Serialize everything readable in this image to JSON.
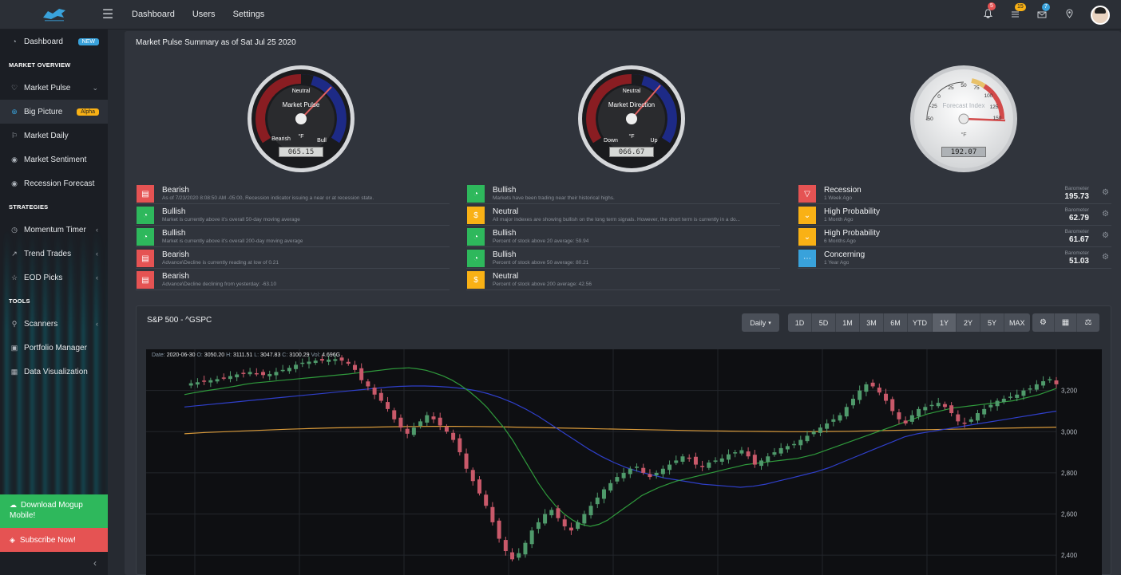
{
  "topbar": {
    "nav": [
      "Dashboard",
      "Users",
      "Settings"
    ],
    "badges": {
      "notifications": "5",
      "list": "15",
      "messages": "7"
    }
  },
  "sidebar": {
    "dashboard": {
      "label": "Dashboard",
      "tag": "NEW"
    },
    "section_market": "MARKET OVERVIEW",
    "market_pulse": "Market Pulse",
    "big_picture": {
      "label": "Big Picture",
      "tag": "Alpha"
    },
    "market_daily": "Market Daily",
    "market_sentiment": "Market Sentiment",
    "recession_forecast": "Recession Forecast",
    "section_strategies": "STRATEGIES",
    "momentum_timer": "Momentum Timer",
    "trend_trades": "Trend Trades",
    "eod_picks": "EOD Picks",
    "section_tools": "TOOLS",
    "scanners": "Scanners",
    "portfolio_manager": "Portfolio Manager",
    "data_visualization": "Data Visualization",
    "download": "Download Mogup Mobile!",
    "subscribe": "Subscribe Now!"
  },
  "summary": {
    "title": "Market Pulse Summary as of Sat Jul 25 2020",
    "gauges": [
      {
        "name": "Market Pulse",
        "top": "Neutral",
        "left": "Bearish",
        "right": "Bull",
        "unit": "°F",
        "readout": "065.15",
        "value": 65.15
      },
      {
        "name": "Market Direction",
        "top": "Neutral",
        "left": "Down",
        "right": "Up",
        "unit": "°F",
        "readout": "066.67",
        "value": 66.67
      },
      {
        "name": "Forecast Index",
        "ticks": [
          "-50",
          "-25",
          "0",
          "25",
          "50",
          "75",
          "100",
          "125",
          "150"
        ],
        "unit": "°F",
        "readout": "192.07",
        "value": 192.07
      }
    ]
  },
  "indicators": {
    "col1": [
      {
        "title": "Bearish",
        "detail": "As of 7/23/2020 8:08:50 AM -05:00, Recession indicator issuing a near or at recession state.",
        "status": "bearish"
      },
      {
        "title": "Bullish",
        "detail": "Market is currently above it's overall 50-day moving average",
        "status": "bullish"
      },
      {
        "title": "Bullish",
        "detail": "Market is currently above it's overall 200-day moving average",
        "status": "bullish"
      },
      {
        "title": "Bearish",
        "detail": "Advance\\Decline is currently reading at low of 0.21",
        "status": "bearish"
      },
      {
        "title": "Bearish",
        "detail": "Advance\\Decline declining from yesterday: -63.10",
        "status": "bearish"
      }
    ],
    "col2": [
      {
        "title": "Bullish",
        "detail": "Markets have been trading near their historical highs.",
        "status": "bullish"
      },
      {
        "title": "Neutral",
        "detail": "All major indexes are showing bullish on the long term signals. However, the short term is currently in a do...",
        "status": "neutral"
      },
      {
        "title": "Bullish",
        "detail": "Percent of stock above 20 average: 59.94",
        "status": "bullish"
      },
      {
        "title": "Bullish",
        "detail": "Percent of stock above 50 average: 80.21",
        "status": "bullish"
      },
      {
        "title": "Neutral",
        "detail": "Percent of stock above 200 average: 42.56",
        "status": "neutral"
      }
    ],
    "col3": [
      {
        "title": "Recession",
        "detail": "1 Week Ago",
        "label": "Barometer",
        "value": "195.73",
        "status": "recession"
      },
      {
        "title": "High Probability",
        "detail": "1 Month Ago",
        "label": "Barometer",
        "value": "62.79",
        "status": "high"
      },
      {
        "title": "High Probability",
        "detail": "6 Months Ago",
        "label": "Barometer",
        "value": "61.67",
        "status": "high"
      },
      {
        "title": "Concerning",
        "detail": "1 Year Ago",
        "label": "Barometer",
        "value": "51.03",
        "status": "concerning"
      }
    ]
  },
  "chartpanel": {
    "title": "S&P 500 - ^GSPC",
    "interval": "Daily",
    "ranges": [
      "1D",
      "5D",
      "1M",
      "3M",
      "6M",
      "YTD",
      "1Y",
      "2Y",
      "5Y",
      "MAX"
    ],
    "active_range": "1Y",
    "ohlc": {
      "date_label": "Date:",
      "date": "2020-06-30",
      "o_label": "O:",
      "o": "3050.20",
      "h_label": "H:",
      "h": "3111.51",
      "l_label": "L:",
      "l": "3047.83",
      "c_label": "C:",
      "c": "3100.29",
      "v_label": "Vol:",
      "v": "4.696G"
    }
  },
  "chart_data": {
    "type": "line",
    "title": "S&P 500 - ^GSPC",
    "ylim": [
      2300,
      3400
    ],
    "yticks": [
      "3,200",
      "3,000",
      "2,800",
      "2,600",
      "2,400"
    ],
    "ytick_values": [
      3200,
      3000,
      2800,
      2600,
      2400
    ],
    "colors": {
      "up": "#4f9a6b",
      "down": "#c9596a",
      "ma20": "#2f9a3c",
      "ma50": "#2f3fc9",
      "ma200": "#d99a3a"
    },
    "closes": [
      3230,
      3235,
      3240,
      3245,
      3250,
      3255,
      3262,
      3270,
      3278,
      3285,
      3290,
      3282,
      3275,
      3280,
      3290,
      3300,
      3310,
      3325,
      3335,
      3340,
      3345,
      3345,
      3350,
      3352,
      3345,
      3330,
      3300,
      3250,
      3220,
      3180,
      3150,
      3110,
      3060,
      3020,
      2990,
      3020,
      3050,
      3080,
      3060,
      3030,
      3000,
      2960,
      2900,
      2820,
      2760,
      2700,
      2640,
      2560,
      2480,
      2420,
      2380,
      2410,
      2460,
      2520,
      2560,
      2600,
      2620,
      2580,
      2540,
      2520,
      2560,
      2600,
      2640,
      2680,
      2720,
      2750,
      2780,
      2800,
      2820,
      2830,
      2800,
      2780,
      2800,
      2820,
      2840,
      2860,
      2880,
      2870,
      2840,
      2830,
      2850,
      2860,
      2870,
      2890,
      2900,
      2910,
      2880,
      2840,
      2860,
      2880,
      2900,
      2920,
      2930,
      2940,
      2960,
      2980,
      3000,
      3020,
      3040,
      3060,
      3080,
      3120,
      3160,
      3200,
      3230,
      3220,
      3190,
      3150,
      3100,
      3060,
      3040,
      3080,
      3110,
      3120,
      3130,
      3140,
      3120,
      3090,
      3050,
      3040,
      3060,
      3090,
      3110,
      3130,
      3150,
      3160,
      3170,
      3180,
      3200,
      3210,
      3230,
      3245,
      3255,
      3230
    ],
    "ma20": [
      3180,
      3188,
      3195,
      3202,
      3208,
      3215,
      3222,
      3230,
      3236,
      3240,
      3244,
      3248,
      3252,
      3256,
      3260,
      3264,
      3268,
      3272,
      3276,
      3280,
      3285,
      3290,
      3295,
      3300,
      3305,
      3308,
      3310,
      3305,
      3298,
      3285,
      3270,
      3250,
      3225,
      3195,
      3160,
      3120,
      3070,
      3020,
      2960,
      2890,
      2820,
      2750,
      2690,
      2640,
      2600,
      2570,
      2550,
      2540,
      2550,
      2570,
      2600,
      2630,
      2660,
      2690,
      2710,
      2730,
      2745,
      2760,
      2770,
      2780,
      2790,
      2800,
      2810,
      2820,
      2830,
      2840,
      2845,
      2850,
      2855,
      2860,
      2865,
      2870,
      2880,
      2890,
      2905,
      2920,
      2935,
      2950,
      2965,
      2980,
      2995,
      3010,
      3025,
      3040,
      3055,
      3070,
      3085,
      3095,
      3105,
      3115,
      3120,
      3125,
      3130,
      3135,
      3140,
      3145,
      3150,
      3160,
      3170,
      3180,
      3195,
      3210
    ],
    "ma50": [
      3120,
      3126,
      3132,
      3138,
      3144,
      3150,
      3156,
      3162,
      3168,
      3174,
      3180,
      3186,
      3192,
      3198,
      3204,
      3210,
      3216,
      3220,
      3222,
      3222,
      3220,
      3216,
      3210,
      3200,
      3185,
      3165,
      3140,
      3110,
      3075,
      3035,
      2995,
      2955,
      2915,
      2880,
      2850,
      2825,
      2805,
      2790,
      2775,
      2765,
      2755,
      2745,
      2740,
      2735,
      2730,
      2735,
      2745,
      2760,
      2775,
      2790,
      2805,
      2825,
      2850,
      2875,
      2900,
      2925,
      2950,
      2975,
      2990,
      3000,
      3010,
      3020,
      3030,
      3040,
      3050,
      3060,
      3070,
      3080,
      3090,
      3100
    ],
    "ma200": [
      2990,
      2996,
      3000,
      3004,
      3008,
      3012,
      3015,
      3018,
      3020,
      3022,
      3024,
      3025,
      3026,
      3026,
      3025,
      3024,
      3022,
      3020,
      3018,
      3016,
      3014,
      3012,
      3010,
      3008,
      3006,
      3004,
      3003,
      3002,
      3001,
      3000,
      3000,
      3001,
      3002,
      3004,
      3006,
      3008,
      3010,
      3012,
      3014,
      3016,
      3018,
      3020,
      3022
    ]
  }
}
